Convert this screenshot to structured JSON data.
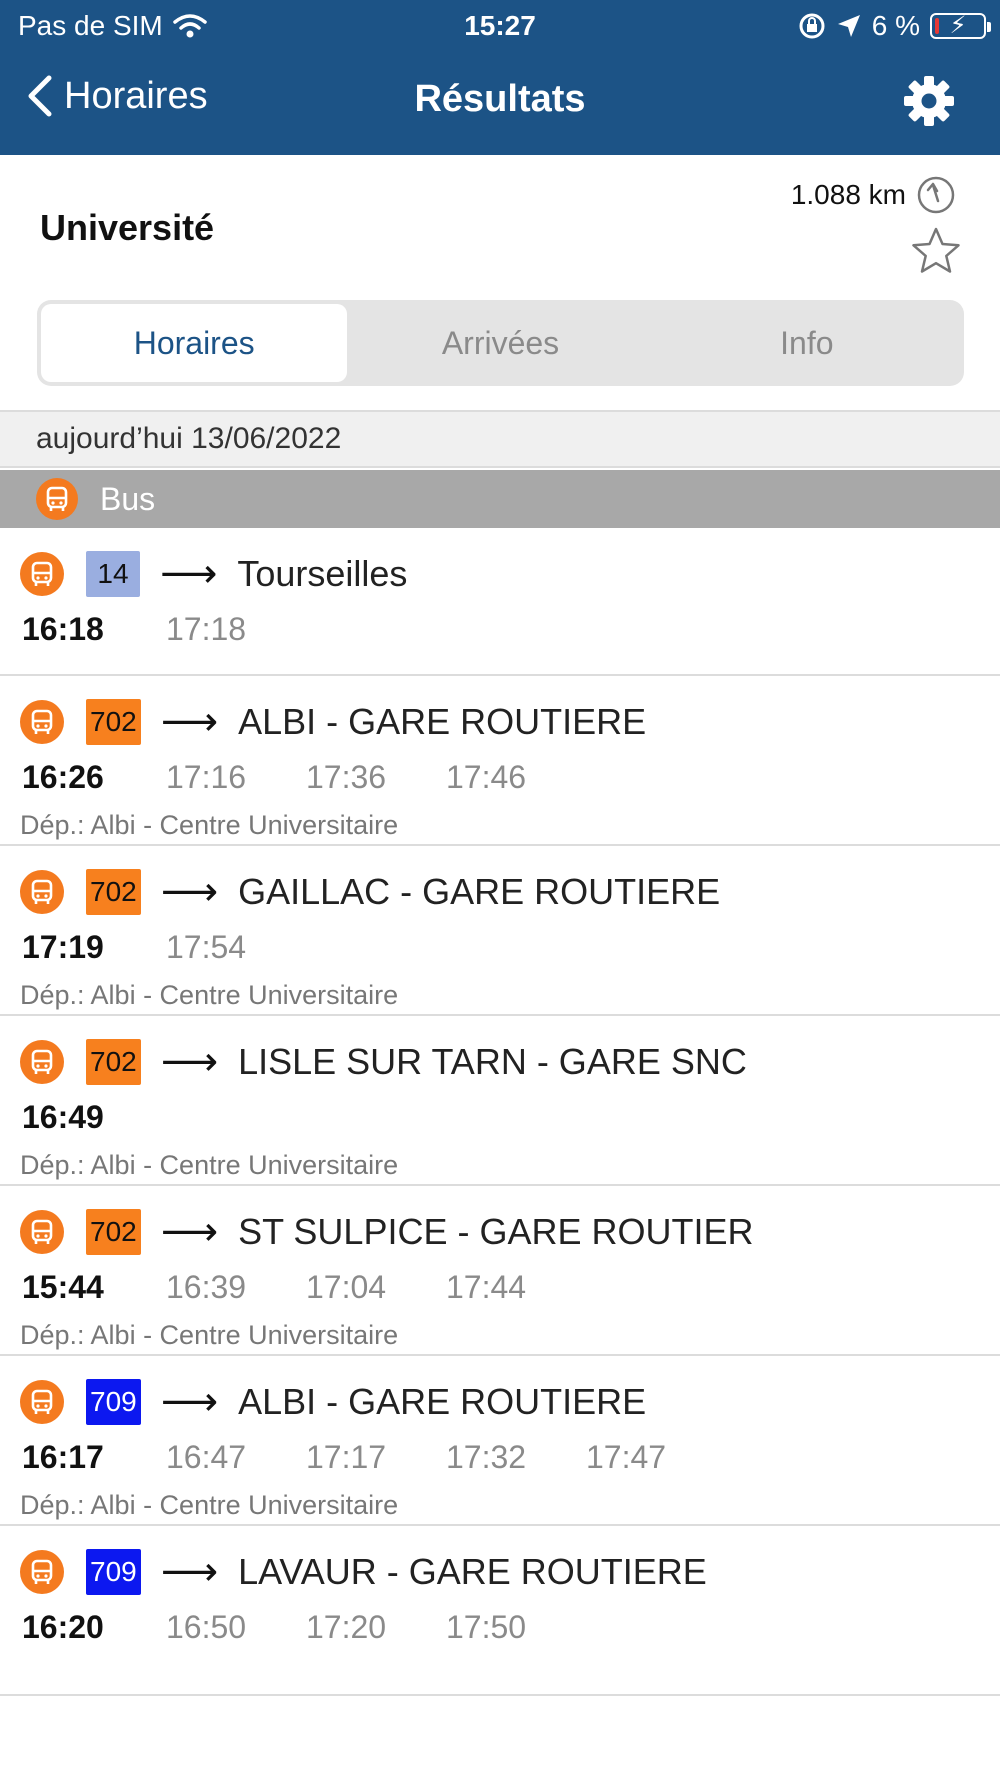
{
  "status_bar": {
    "carrier": "Pas de SIM",
    "time": "15:27",
    "battery": "6 %",
    "battery_level": 0.06
  },
  "nav": {
    "back_label": "Horaires",
    "title": "Résultats"
  },
  "stop": {
    "name": "Université",
    "distance": "1.088 km"
  },
  "tabs": [
    {
      "label": "Horaires",
      "active": true
    },
    {
      "label": "Arrivées",
      "active": false
    },
    {
      "label": "Info",
      "active": false
    }
  ],
  "date_label": "aujourd’hui 13/06/2022",
  "mode_label": "Bus",
  "colors": {
    "header": "#1c5386",
    "bus_orange": "#f47a1f",
    "line_14": "#9aaee0",
    "line_702": "#f7801e",
    "line_709": "#0c18f0"
  },
  "departures": [
    {
      "line": "14",
      "line_color": "#9aaee0",
      "line_text_color": "#111111",
      "destination": "Tourseilles",
      "first": "16:18",
      "next": [
        "17:18"
      ],
      "dep": ""
    },
    {
      "line": "702",
      "line_color": "#f7801e",
      "line_text_color": "#111111",
      "destination": "ALBI - GARE ROUTIERE",
      "first": "16:26",
      "next": [
        "17:16",
        "17:36",
        "17:46"
      ],
      "dep": "Dép.: Albi - Centre Universitaire"
    },
    {
      "line": "702",
      "line_color": "#f7801e",
      "line_text_color": "#111111",
      "destination": "GAILLAC - GARE ROUTIERE",
      "first": "17:19",
      "next": [
        "17:54"
      ],
      "dep": "Dép.: Albi - Centre Universitaire"
    },
    {
      "line": "702",
      "line_color": "#f7801e",
      "line_text_color": "#111111",
      "destination": "LISLE SUR TARN - GARE SNC",
      "first": "16:49",
      "next": [],
      "dep": "Dép.: Albi - Centre Universitaire"
    },
    {
      "line": "702",
      "line_color": "#f7801e",
      "line_text_color": "#111111",
      "destination": "ST SULPICE - GARE ROUTIER",
      "first": "15:44",
      "next": [
        "16:39",
        "17:04",
        "17:44"
      ],
      "dep": "Dép.: Albi - Centre Universitaire"
    },
    {
      "line": "709",
      "line_color": "#0c18f0",
      "line_text_color": "#ffffff",
      "destination": "ALBI - GARE ROUTIERE",
      "first": "16:17",
      "next": [
        "16:47",
        "17:17",
        "17:32",
        "17:47"
      ],
      "dep": "Dép.: Albi - Centre Universitaire"
    },
    {
      "line": "709",
      "line_color": "#0c18f0",
      "line_text_color": "#ffffff",
      "destination": "LAVAUR - GARE ROUTIERE",
      "first": "16:20",
      "next": [
        "16:50",
        "17:20",
        "17:50"
      ],
      "dep": ""
    }
  ]
}
